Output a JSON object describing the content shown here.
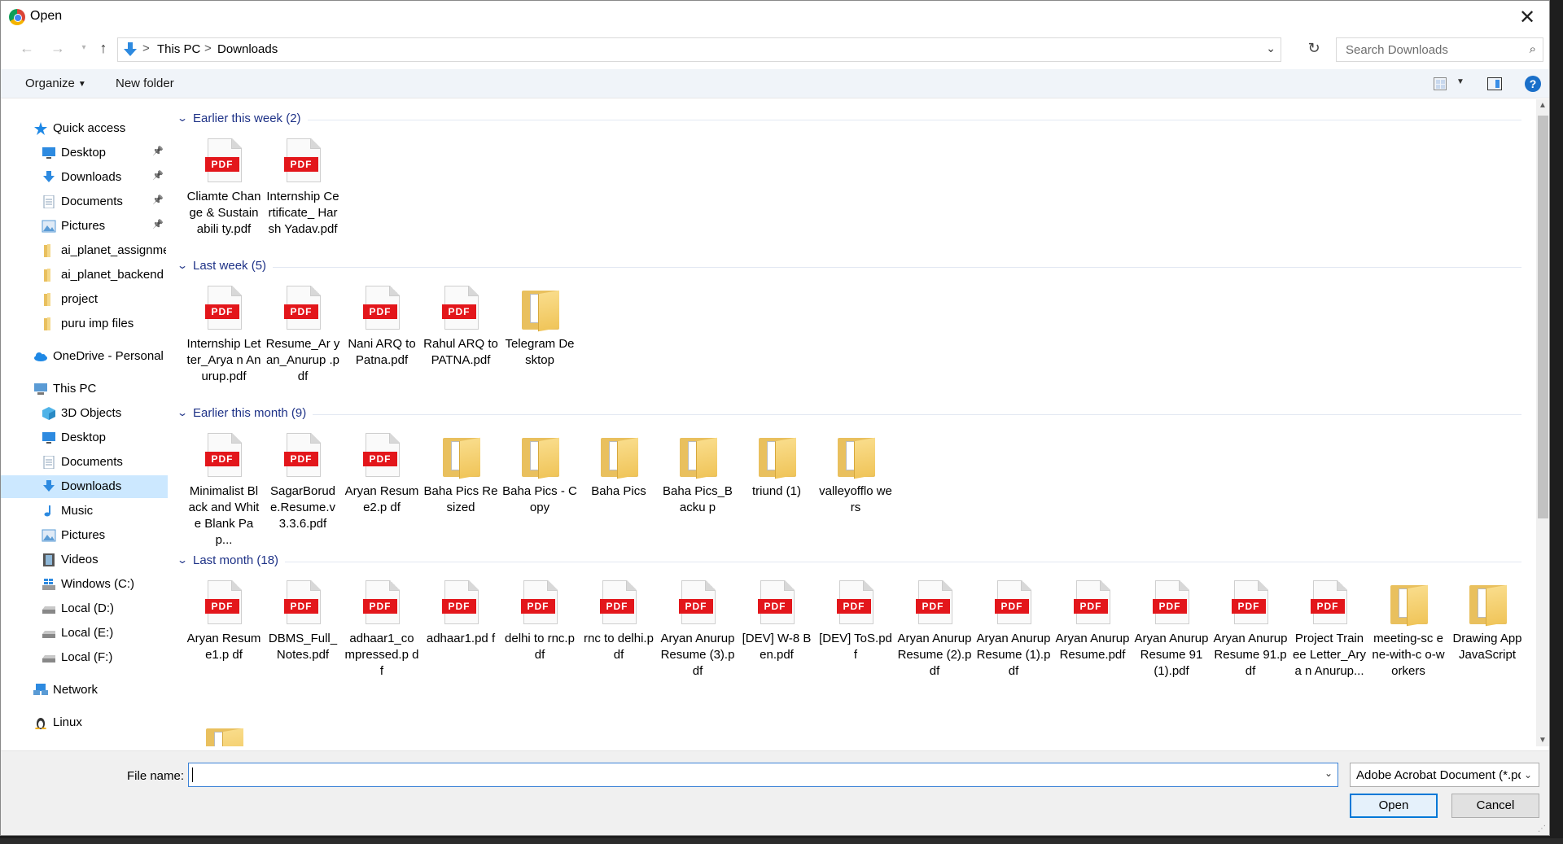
{
  "window": {
    "title": "Open",
    "app_icon": "chrome-icon",
    "close_icon": "close-icon"
  },
  "address": {
    "crumbs": [
      "This PC",
      "Downloads"
    ],
    "separator": ">",
    "search_placeholder": "Search Downloads"
  },
  "toolbar": {
    "organize_label": "Organize",
    "new_folder_label": "New folder",
    "help_label": "?"
  },
  "nav": {
    "items": [
      {
        "label": "Quick access",
        "icon": "star-icon",
        "color": "#1e88e5",
        "pinned": false,
        "indent": 1
      },
      {
        "label": "Desktop",
        "icon": "desktop-icon",
        "color": "#2d8ae0",
        "pinned": true,
        "indent": 2
      },
      {
        "label": "Downloads",
        "icon": "download-icon",
        "color": "#2d8ae0",
        "pinned": true,
        "indent": 2
      },
      {
        "label": "Documents",
        "icon": "document-icon",
        "color": "#8aa0b8",
        "pinned": true,
        "indent": 2
      },
      {
        "label": "Pictures",
        "icon": "pictures-icon",
        "color": "#5a9bd5",
        "pinned": true,
        "indent": 2
      },
      {
        "label": "ai_planet_assignment",
        "icon": "folder-icon",
        "color": "#e9c05e",
        "pinned": false,
        "indent": 2
      },
      {
        "label": "ai_planet_backend",
        "icon": "folder-icon",
        "color": "#e9c05e",
        "pinned": false,
        "indent": 2
      },
      {
        "label": "project",
        "icon": "folder-icon",
        "color": "#e9c05e",
        "pinned": false,
        "indent": 2
      },
      {
        "label": "puru imp files",
        "icon": "folder-icon",
        "color": "#e9c05e",
        "pinned": false,
        "indent": 2
      },
      {
        "label": "OneDrive - Personal",
        "icon": "cloud-icon",
        "color": "#1e88e5",
        "pinned": false,
        "indent": 1
      },
      {
        "label": "This PC",
        "icon": "computer-icon",
        "color": "#5a9bd5",
        "pinned": false,
        "indent": 1
      },
      {
        "label": "3D Objects",
        "icon": "cube-icon",
        "color": "#4fb3e8",
        "pinned": false,
        "indent": 2
      },
      {
        "label": "Desktop",
        "icon": "desktop-icon",
        "color": "#2d8ae0",
        "pinned": false,
        "indent": 2
      },
      {
        "label": "Documents",
        "icon": "document-icon",
        "color": "#8aa0b8",
        "pinned": false,
        "indent": 2
      },
      {
        "label": "Downloads",
        "icon": "download-icon",
        "color": "#2d8ae0",
        "pinned": false,
        "indent": 2,
        "selected": true
      },
      {
        "label": "Music",
        "icon": "music-icon",
        "color": "#2d8ae0",
        "pinned": false,
        "indent": 2
      },
      {
        "label": "Pictures",
        "icon": "pictures-icon",
        "color": "#5a9bd5",
        "pinned": false,
        "indent": 2
      },
      {
        "label": "Videos",
        "icon": "film-icon",
        "color": "#555555",
        "pinned": false,
        "indent": 2
      },
      {
        "label": "Windows (C:)",
        "icon": "windows-drive-icon",
        "color": "#2d8ae0",
        "pinned": false,
        "indent": 2
      },
      {
        "label": "Local (D:)",
        "icon": "drive-icon",
        "color": "#888888",
        "pinned": false,
        "indent": 2
      },
      {
        "label": "Local (E:)",
        "icon": "drive-icon",
        "color": "#888888",
        "pinned": false,
        "indent": 2
      },
      {
        "label": "Local (F:)",
        "icon": "drive-icon",
        "color": "#888888",
        "pinned": false,
        "indent": 2
      },
      {
        "label": "Network",
        "icon": "network-icon",
        "color": "#2d8ae0",
        "pinned": false,
        "indent": 1
      },
      {
        "label": "Linux",
        "icon": "linux-icon",
        "color": "#333333",
        "pinned": false,
        "indent": 1
      }
    ]
  },
  "groups": [
    {
      "title": "Earlier this week (2)",
      "files": [
        {
          "name": "Cliamte Change & Sustainabili ty.pdf",
          "type": "pdf"
        },
        {
          "name": "Internship Certificate_ Harsh Yadav.pdf",
          "type": "pdf"
        }
      ]
    },
    {
      "title": "Last week (5)",
      "files": [
        {
          "name": "Internship Letter_Arya n Anurup.pdf",
          "type": "pdf"
        },
        {
          "name": "Resume_Ar yan_Anurup .pdf",
          "type": "pdf"
        },
        {
          "name": "Nani ARQ to Patna.pdf",
          "type": "pdf"
        },
        {
          "name": "Rahul ARQ to PATNA.pdf",
          "type": "pdf"
        },
        {
          "name": "Telegram Desktop",
          "type": "folder"
        }
      ]
    },
    {
      "title": "Earlier this month (9)",
      "files": [
        {
          "name": "Minimalist Black and White Blank Pap...",
          "type": "pdf"
        },
        {
          "name": "SagarBorud e.Resume.v 3.3.6.pdf",
          "type": "pdf"
        },
        {
          "name": "Aryan Resume2.p df",
          "type": "pdf"
        },
        {
          "name": "Baha Pics Resized",
          "type": "folder"
        },
        {
          "name": "Baha Pics - Copy",
          "type": "folder"
        },
        {
          "name": "Baha Pics",
          "type": "folder"
        },
        {
          "name": "Baha Pics_Backu p",
          "type": "folder"
        },
        {
          "name": "triund (1)",
          "type": "folder"
        },
        {
          "name": "valleyofflo wers",
          "type": "folder"
        }
      ]
    },
    {
      "title": "Last month (18)",
      "files": [
        {
          "name": "Aryan Resume1.p df",
          "type": "pdf"
        },
        {
          "name": "DBMS_Full_ Notes.pdf",
          "type": "pdf"
        },
        {
          "name": "adhaar1_co mpressed.p df",
          "type": "pdf"
        },
        {
          "name": "adhaar1.pd f",
          "type": "pdf"
        },
        {
          "name": "delhi to rnc.pdf",
          "type": "pdf"
        },
        {
          "name": "rnc to delhi.pdf",
          "type": "pdf"
        },
        {
          "name": "Aryan Anurup Resume (3).pdf",
          "type": "pdf"
        },
        {
          "name": "[DEV] W-8 Ben.pdf",
          "type": "pdf"
        },
        {
          "name": "[DEV] ToS.pdf",
          "type": "pdf"
        },
        {
          "name": "Aryan Anurup Resume (2).pdf",
          "type": "pdf"
        },
        {
          "name": "Aryan Anurup Resume (1).pdf",
          "type": "pdf"
        },
        {
          "name": "Aryan Anurup Resume.pdf",
          "type": "pdf"
        },
        {
          "name": "Aryan Anurup Resume 91 (1).pdf",
          "type": "pdf"
        },
        {
          "name": "Aryan Anurup Resume 91.pdf",
          "type": "pdf"
        },
        {
          "name": "Project Trainee Letter_Arya n Anurup...",
          "type": "pdf"
        },
        {
          "name": "meeting-sc ene-with-c o-workers",
          "type": "folder"
        },
        {
          "name": "Drawing App JavaScript",
          "type": "folder"
        },
        {
          "name": "",
          "type": "folder"
        }
      ]
    }
  ],
  "pdf_badge": "PDF",
  "footer": {
    "file_name_label": "File name:",
    "file_name_value": "",
    "filter_value": "Adobe Acrobat Document (*.pdf)",
    "open_label": "Open",
    "cancel_label": "Cancel"
  },
  "colors": {
    "accent": "#0078d7",
    "group_header": "#1e3287",
    "pdf_red": "#e3161b",
    "folder": "#e9c05e",
    "selection": "#cce8ff"
  }
}
